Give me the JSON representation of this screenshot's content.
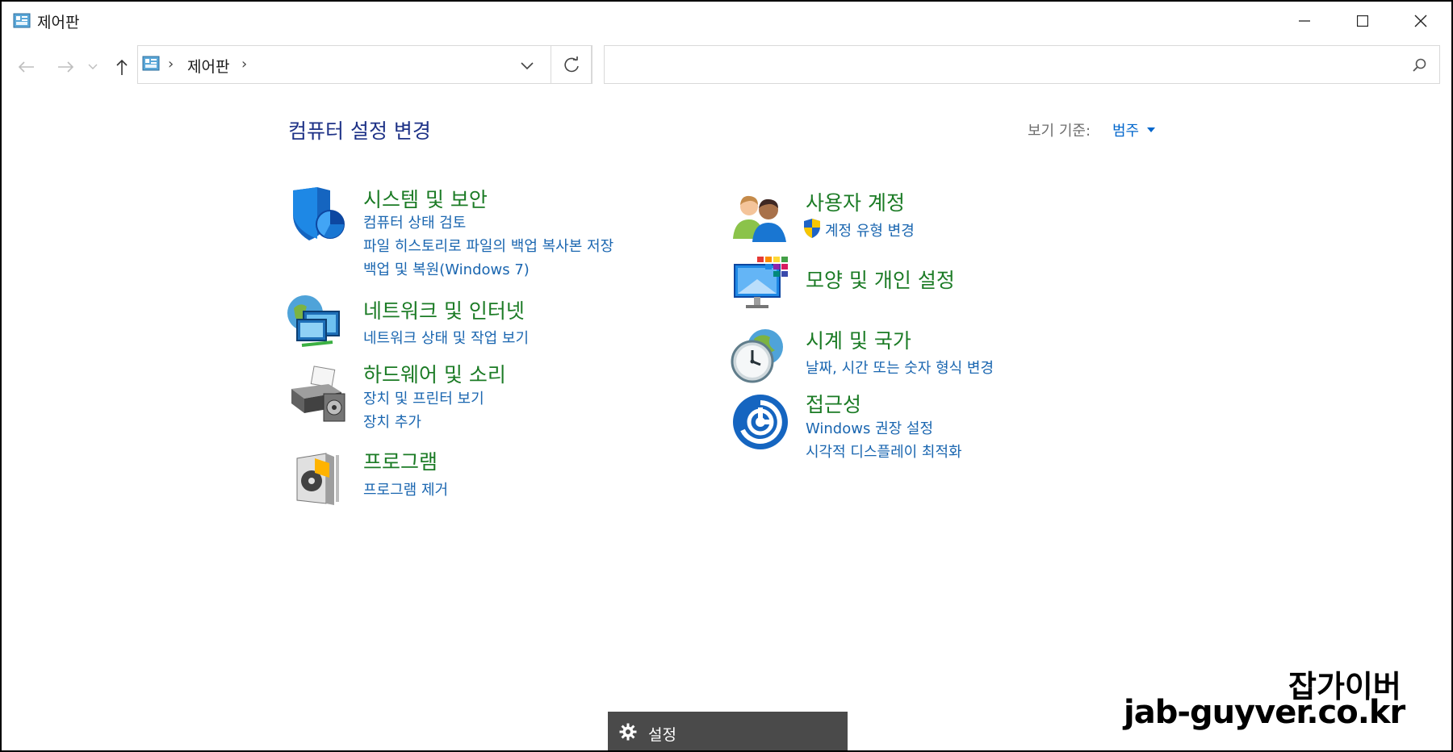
{
  "window": {
    "title": "제어판"
  },
  "nav": {
    "back": "←",
    "forward": "→",
    "up": "↑"
  },
  "address": {
    "crumb": "제어판",
    "sep1": "›",
    "sep2": "›"
  },
  "search": {
    "placeholder": ""
  },
  "content": {
    "heading": "컴퓨터 설정 변경",
    "view_by_label": "보기 기준:",
    "view_by_value": "범주"
  },
  "categories": {
    "system": {
      "title": "시스템 및 보안",
      "links": [
        "컴퓨터 상태 검토",
        "파일 히스토리로 파일의 백업 복사본 저장",
        "백업 및 복원(Windows 7)"
      ]
    },
    "network": {
      "title": "네트워크 및 인터넷",
      "links": [
        "네트워크 상태 및 작업 보기"
      ]
    },
    "hardware": {
      "title": "하드웨어 및 소리",
      "links": [
        "장치 및 프린터 보기",
        "장치 추가"
      ]
    },
    "programs": {
      "title": "프로그램",
      "links": [
        "프로그램 제거"
      ]
    },
    "users": {
      "title": "사용자 계정",
      "links": [
        "계정 유형 변경"
      ]
    },
    "appearance": {
      "title": "모양 및 개인 설정",
      "links": []
    },
    "clock": {
      "title": "시계 및 국가",
      "links": [
        "날짜, 시간 또는 숫자 형식 변경"
      ]
    },
    "access": {
      "title": "접근성",
      "links": [
        "Windows 권장 설정",
        "시각적 디스플레이 최적화"
      ]
    }
  },
  "taskbar": {
    "settings_label": "설정"
  },
  "watermark": {
    "line1": "잡가이버",
    "line2": "jab-guyver.co.kr"
  },
  "colors": {
    "category_title": "#1b7b25",
    "link": "#1a66b0",
    "heading": "#1e3287"
  }
}
